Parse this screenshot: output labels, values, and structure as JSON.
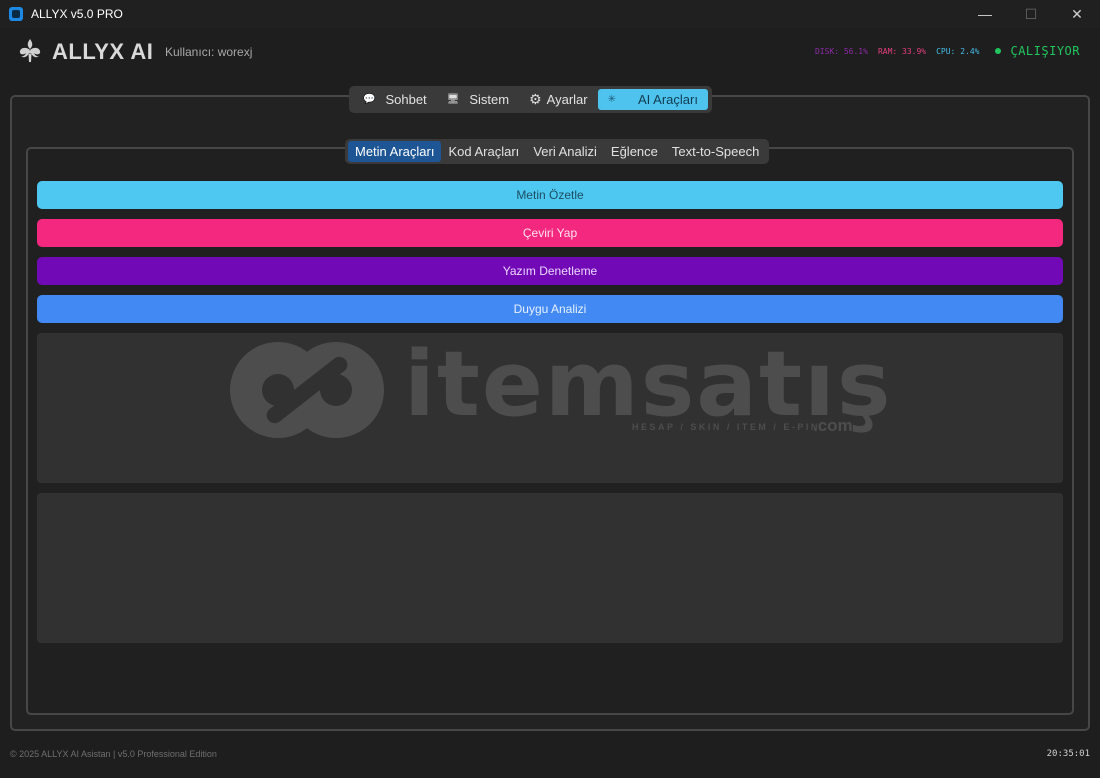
{
  "window": {
    "title": "ALLYX v5.0 PRO",
    "controls": {
      "minimize": "—",
      "maximize": "☐",
      "close": "✕"
    }
  },
  "header": {
    "brand": "ALLYX AI",
    "user_label": "Kullanıcı: worexj",
    "stats": {
      "disk": "DISK: 56.1%",
      "ram": "RAM: 33.9%",
      "cpu": "CPU: 2.4%"
    },
    "status": "ÇALIŞIYOR"
  },
  "main_tabs": [
    {
      "label": "Sohbet",
      "icon": "chat-bubble-icon",
      "glyph": "💬"
    },
    {
      "label": "Sistem",
      "icon": "computer-icon",
      "glyph": "🖥"
    },
    {
      "label": "Ayarlar",
      "icon": "gear-icon",
      "glyph": "⚙"
    },
    {
      "label": "AI Araçları",
      "icon": "ai-icon",
      "glyph": "✳"
    }
  ],
  "active_main_tab": "AI Araçları",
  "sub_tabs": [
    "Metin Araçları",
    "Kod Araçları",
    "Veri Analizi",
    "Eğlence",
    "Text-to-Speech"
  ],
  "active_sub_tab": "Metin Araçları",
  "tools": {
    "summarize": "Metin Özetle",
    "translate": "Çeviri Yap",
    "spellcheck": "Yazım Denetleme",
    "sentiment": "Duygu Analizi"
  },
  "watermark": {
    "name": "itemsatış",
    "tagline": "HESAP / SKIN / ITEM / E-PIN",
    "suffix": ".com"
  },
  "footer": {
    "copyright": "© 2025 ALLYX AI Asistan | v5.0 Professional Edition",
    "time": "20:35:01"
  },
  "colors": {
    "accent_cyan": "#4ec8f0",
    "pink": "#f4287f",
    "purple": "#7209b7",
    "blue": "#4289f3",
    "status_green": "#22c55e",
    "sub_tab_active": "#1e5695"
  }
}
